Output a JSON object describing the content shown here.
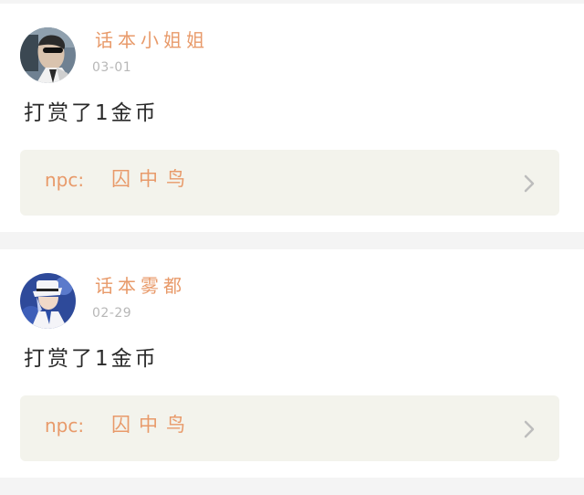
{
  "feed": {
    "items": [
      {
        "username": "话本小姐姐",
        "date": "03-01",
        "message": "打赏了1金币",
        "npc_prefix": "npc:",
        "npc_name": "囚中鸟",
        "avatar_icon": "woman-sunglasses-avatar",
        "chevron_icon": "chevron-right-icon"
      },
      {
        "username": "话本雾都",
        "date": "02-29",
        "message": "打赏了1金币",
        "npc_prefix": "npc:",
        "npc_name": "囚中鸟",
        "avatar_icon": "anime-character-avatar",
        "chevron_icon": "chevron-right-icon"
      }
    ]
  },
  "colors": {
    "accent": "#e89a6a",
    "date": "#b7b7b7",
    "text": "#2a2a2a",
    "npc_bg": "#f3f3ec",
    "page_bg": "#f4f4f4"
  }
}
